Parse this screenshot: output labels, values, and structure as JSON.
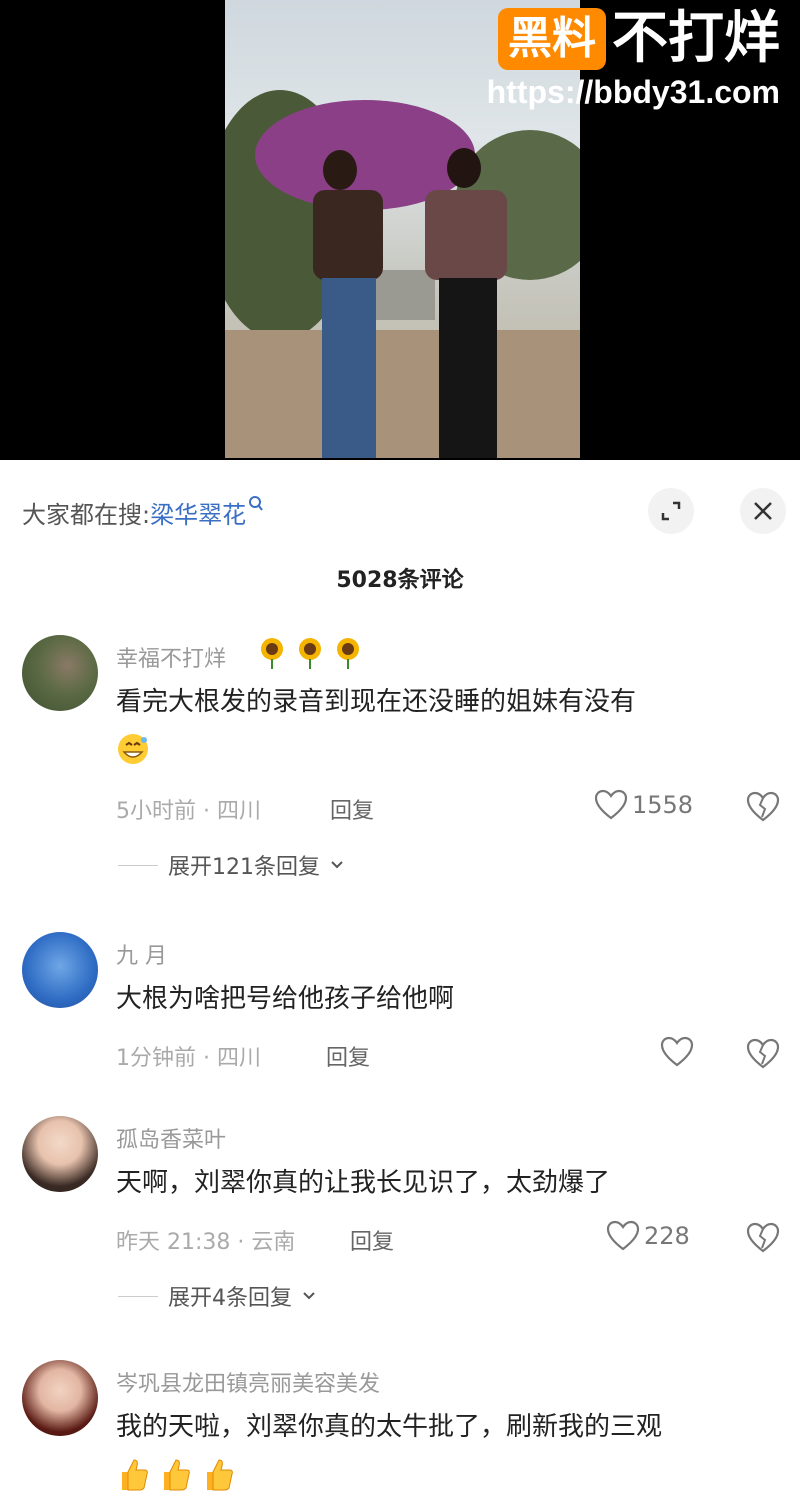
{
  "watermark": {
    "badge": "黑料",
    "title": "不打烊",
    "url": "https://bbdy31.com"
  },
  "search": {
    "prefix": "大家都在搜:",
    "keyword": "梁华翠花"
  },
  "comments_count": "5028条评论",
  "comments": [
    {
      "name": "幸福不打烊",
      "text": "看完大根发的录音到现在还没睡的姐妹有没有",
      "time": "5小时前 · 四川",
      "reply": "回复",
      "likes": "1558",
      "expand": "展开121条回复"
    },
    {
      "name": "九 月",
      "text": "大根为啥把号给他孩子给他啊",
      "time": "1分钟前 · 四川",
      "reply": "回复"
    },
    {
      "name": "孤岛香菜叶",
      "text": "天啊，刘翠你真的让我长见识了，太劲爆了",
      "time": "昨天 21:38 · 云南",
      "reply": "回复",
      "likes": "228",
      "expand": "展开4条回复"
    },
    {
      "name": "岑巩县龙田镇亮丽美容美发",
      "text": "我的天啦，刘翠你真的太牛批了，刷新我的三观"
    }
  ],
  "colors": {
    "accent": "#3b6fc4",
    "watermark_badge": "#ff8a00"
  }
}
